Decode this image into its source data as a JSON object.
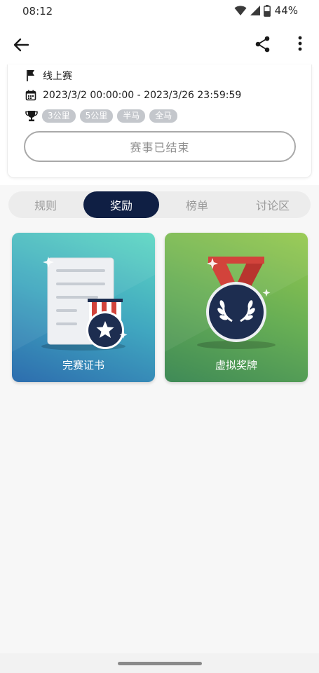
{
  "status": {
    "time": "08:12",
    "battery": "44%"
  },
  "appbar": {
    "back_icon": "arrow-left-icon",
    "share_icon": "share-icon",
    "more_icon": "more-vert-icon"
  },
  "event": {
    "type_label": "线上赛",
    "date_range": "2023/3/2 00:00:00 - 2023/3/26 23:59:59",
    "tags": [
      "3公里",
      "5公里",
      "半马",
      "全马"
    ],
    "status_button": "赛事已结束"
  },
  "tabs": [
    {
      "label": "规则",
      "active": false
    },
    {
      "label": "奖励",
      "active": true
    },
    {
      "label": "榜单",
      "active": false
    },
    {
      "label": "讨论区",
      "active": false
    }
  ],
  "awards": [
    {
      "title": "完赛证书",
      "icon": "certificate-icon"
    },
    {
      "title": "虚拟奖牌",
      "icon": "medal-icon"
    }
  ],
  "colors": {
    "active_tab": "#0f1f44",
    "tag_bg": "#c4c7cc",
    "cert_card": "#40a7c0",
    "medal_card": "#67ae55"
  }
}
